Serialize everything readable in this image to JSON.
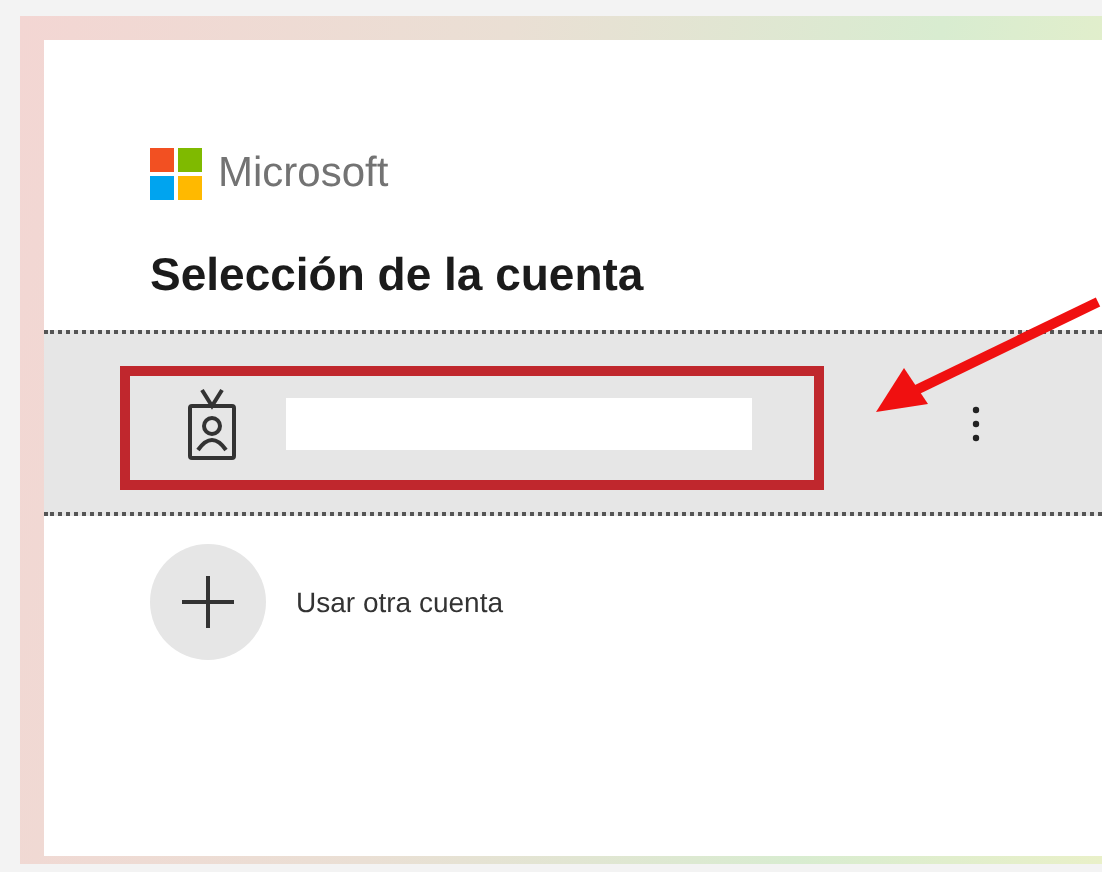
{
  "brand": {
    "name": "Microsoft"
  },
  "title": "Selección de la cuenta",
  "accounts": [
    {
      "selected": true,
      "redacted": true
    }
  ],
  "other_account": {
    "label": "Usar otra cuenta"
  },
  "annotations": [
    {
      "kind": "box",
      "color": "#c0272d"
    },
    {
      "kind": "arrow",
      "color": "#f01010"
    }
  ]
}
